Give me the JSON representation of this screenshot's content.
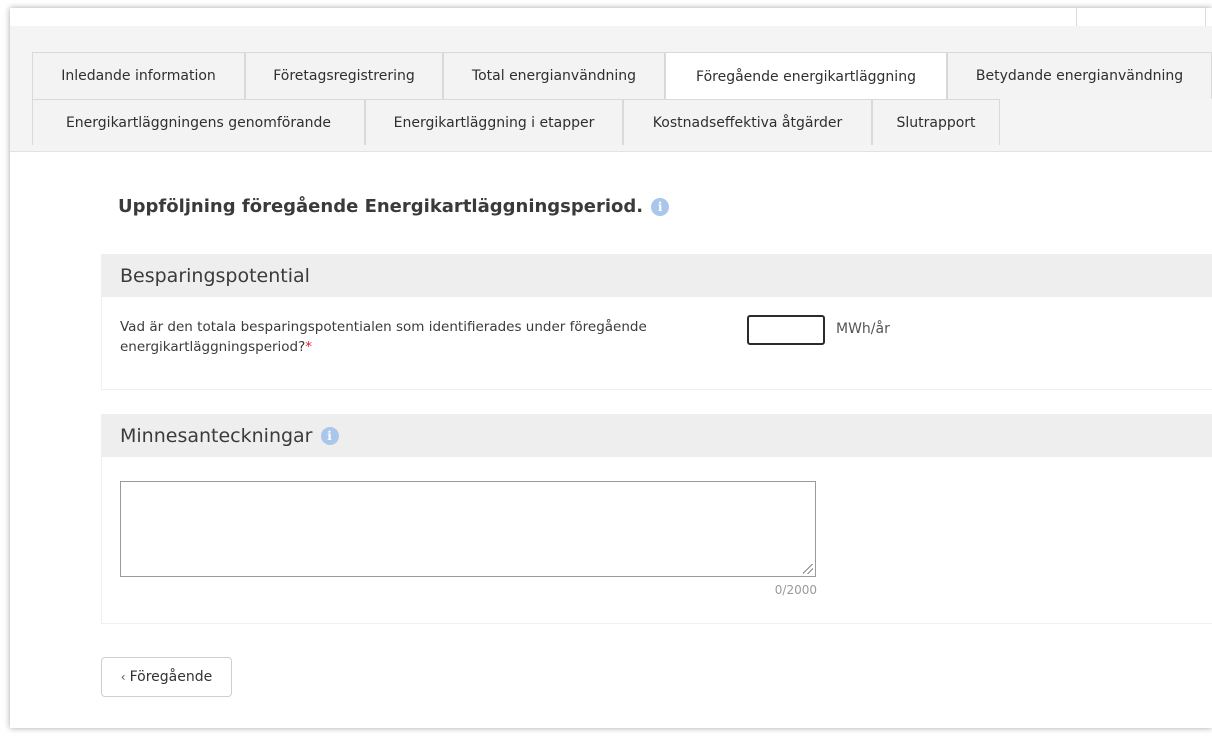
{
  "tabs_row1": [
    {
      "label": "Inledande information"
    },
    {
      "label": "Företagsregistrering"
    },
    {
      "label": "Total energianvändning"
    },
    {
      "label": "Föregående energikartläggning",
      "active": true
    },
    {
      "label": "Betydande energianvändning"
    }
  ],
  "tabs_row2": [
    {
      "label": "Energikartläggningens genomförande"
    },
    {
      "label": "Energikartläggning i etapper"
    },
    {
      "label": "Kostnadseffektiva åtgärder"
    },
    {
      "label": "Slutrapport"
    }
  ],
  "page": {
    "title": "Uppföljning föregående Energikartläggningsperiod.",
    "info_icon": "i"
  },
  "savings": {
    "header": "Besparingspotential",
    "question": "Vad är den totala besparingspotentialen som identifierades under föregående energikartläggningsperiod?",
    "required_mark": "*",
    "value": "",
    "unit": "MWh/år"
  },
  "notes": {
    "header": "Minnesanteckningar",
    "info_icon": "i",
    "value": "",
    "counter": "0/2000"
  },
  "nav": {
    "prev_chevron": "‹",
    "prev_label": "Föregående"
  },
  "colors": {
    "tab_bg": "#f3f3f3",
    "active_tab_bg": "#ffffff",
    "section_header_bg": "#eeeeee",
    "info_icon": "#a9c7ea",
    "required": "#d9232e"
  }
}
